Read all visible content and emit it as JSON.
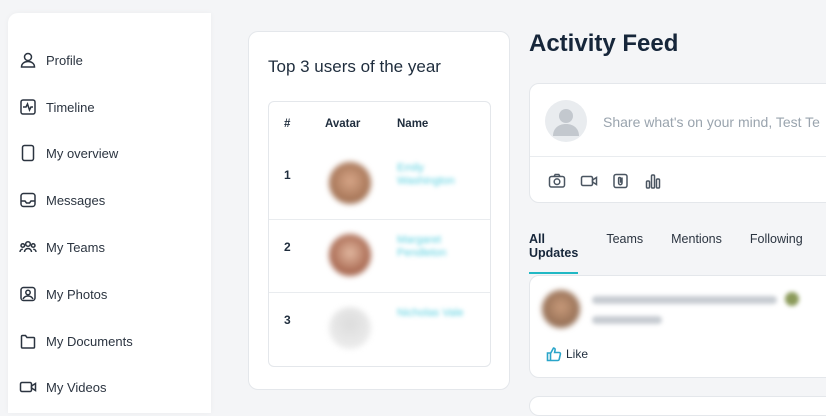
{
  "sidebar": {
    "items": [
      {
        "label": "Profile",
        "icon": "user-icon"
      },
      {
        "label": "Timeline",
        "icon": "timeline-icon"
      },
      {
        "label": "My overview",
        "icon": "document-icon"
      },
      {
        "label": "Messages",
        "icon": "inbox-icon"
      },
      {
        "label": "My Teams",
        "icon": "team-icon"
      },
      {
        "label": "My Photos",
        "icon": "photo-icon"
      },
      {
        "label": "My Documents",
        "icon": "folder-icon"
      },
      {
        "label": "My Videos",
        "icon": "video-icon"
      }
    ]
  },
  "top_users": {
    "title": "Top 3 users of the year",
    "columns": [
      "#",
      "Avatar",
      "Name"
    ],
    "rows": [
      {
        "rank": "1",
        "name": "Emily Washington"
      },
      {
        "rank": "2",
        "name": "Margaret Pendleton"
      },
      {
        "rank": "3",
        "name": "Nicholas Vale"
      }
    ]
  },
  "feed": {
    "title": "Activity Feed",
    "composer_placeholder": "Share what's on your mind, Test Te",
    "tools": [
      "camera-icon",
      "video-icon",
      "attachment-icon",
      "poll-icon"
    ],
    "tabs": [
      "All Updates",
      "Teams",
      "Mentions",
      "Following"
    ],
    "active_tab": "All Updates",
    "post": {
      "like_label": "Like"
    }
  },
  "colors": {
    "accent": "#21b8c4",
    "like": "#2aa5c9"
  }
}
